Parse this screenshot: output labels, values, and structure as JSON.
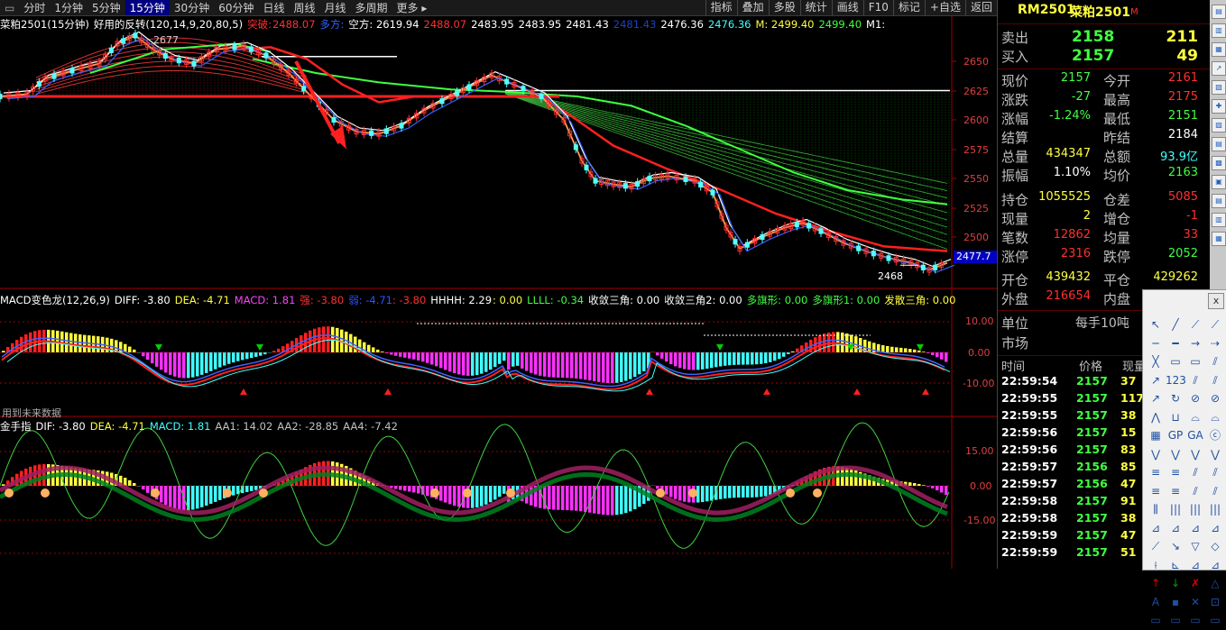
{
  "toolbar": {
    "periods": [
      "分时",
      "1分钟",
      "5分钟",
      "15分钟",
      "30分钟",
      "60分钟",
      "日线",
      "周线",
      "月线",
      "多周期",
      "更多 ▸"
    ],
    "active_period": "15分钟",
    "right_tools": [
      "指标",
      "叠加",
      "多股",
      "统计",
      "画线",
      "F10",
      "标记",
      "+自选",
      "返回"
    ]
  },
  "main_header": {
    "symbol_period": "菜粕2501(15分钟)",
    "indicator": "好用的反转(120,14,9,20,80,5)",
    "tupo_label": "突破:",
    "tupo_value": "2488.07",
    "duofang": "多方:",
    "kongfang": "空方: 2619.94",
    "v1": "2488.07",
    "v2": "2483.95",
    "v3": "2483.95",
    "v4": "2481.43",
    "v5": "2481.43",
    "v6": "2476.36",
    "v7": "2476.36",
    "m_label": "M: 2499.40",
    "m2": "2499.40",
    "m1_label": "M1:"
  },
  "main_axis": {
    "ticks": [
      "2650",
      "2625",
      "2600",
      "2575",
      "2550",
      "2525",
      "2500"
    ],
    "current_price_tag": "2477.7",
    "low_marker": "2468",
    "high_marker": "2677"
  },
  "macd_header": {
    "name": "MACD变色龙(12,26,9)",
    "diff": "DIFF: -3.80",
    "dea": "DEA: -4.71",
    "macd": "MACD: 1.81",
    "qiang": "强: -3.80",
    "ruo": "弱: -4.71",
    "ruo2": ": -3.80",
    "hhhh": "HHHH: 2.29",
    "hhhh2": ": 0.00",
    "llll": "LLLL: -0.34",
    "sl1": "收敛三角: 0.00",
    "sl2": "收敛三角2: 0.00",
    "dqx": "多旗形: 0.00",
    "dqx1": "多旗形1: 0.00",
    "fssj": "发散三角: 0.00",
    "ticks": [
      "10.00",
      "0.00",
      "-10.00"
    ],
    "note": "用到未来数据"
  },
  "jsz_header": {
    "name": "金手指",
    "dif": "DIF: -3.80",
    "dea": "DEA: -4.71",
    "macd": "MACD: 1.81",
    "aa1": "AA1: 14.02",
    "aa2": "AA2: -28.85",
    "aa4": "AA4: -7.42",
    "ticks": [
      "15.00",
      "0.00",
      "-15.00"
    ]
  },
  "quote": {
    "code": "RM2501",
    "name": "菜粕2501",
    "market_flag": "M",
    "sell_label": "卖出",
    "sell_price": "2158",
    "sell_vol": "211",
    "buy_label": "买入",
    "buy_price": "2157",
    "buy_vol": "49",
    "rows": [
      {
        "l1": "现价",
        "v1": "2157",
        "l2": "今开",
        "v2": "2161"
      },
      {
        "l1": "涨跌",
        "v1": "-27",
        "l2": "最高",
        "v2": "2175"
      },
      {
        "l1": "涨幅",
        "v1": "-1.24%",
        "l2": "最低",
        "v2": "2151"
      },
      {
        "l1": "结算",
        "v1": "",
        "l2": "昨结",
        "v2": "2184"
      },
      {
        "l1": "总量",
        "v1": "434347",
        "l2": "总额",
        "v2": "93.9亿"
      },
      {
        "l1": "振幅",
        "v1": "1.10%",
        "l2": "均价",
        "v2": "2163"
      },
      {
        "l1": "持仓",
        "v1": "1055525",
        "l2": "仓差",
        "v2": "5085"
      },
      {
        "l1": "现量",
        "v1": "2",
        "l2": "增仓",
        "v2": "-1"
      },
      {
        "l1": "笔数",
        "v1": "12862",
        "l2": "均量",
        "v2": "33"
      },
      {
        "l1": "涨停",
        "v1": "2316",
        "l2": "跌停",
        "v2": "2052"
      },
      {
        "l1": "开仓",
        "v1": "439432",
        "l2": "平仓",
        "v2": "429262"
      },
      {
        "l1": "外盘",
        "v1": "216654",
        "l2": "内盘",
        "v2": ""
      }
    ],
    "unit_label": "单位",
    "unit_value": "每手10吨",
    "market_label": "市场",
    "tick_headers": [
      "时间",
      "价格",
      "现量"
    ],
    "ticks": [
      {
        "t": "22:59:54",
        "p": "2157",
        "v": "37"
      },
      {
        "t": "22:59:55",
        "p": "2157",
        "v": "117"
      },
      {
        "t": "22:59:55",
        "p": "2157",
        "v": "38"
      },
      {
        "t": "22:59:56",
        "p": "2157",
        "v": "15"
      },
      {
        "t": "22:59:56",
        "p": "2157",
        "v": "83"
      },
      {
        "t": "22:59:57",
        "p": "2156",
        "v": "85"
      },
      {
        "t": "22:59:57",
        "p": "2156",
        "v": "47"
      },
      {
        "t": "22:59:58",
        "p": "2157",
        "v": "91"
      },
      {
        "t": "22:59:58",
        "p": "2157",
        "v": "38"
      },
      {
        "t": "22:59:59",
        "p": "2157",
        "v": "47"
      },
      {
        "t": "22:59:59",
        "p": "2157",
        "v": "51"
      }
    ]
  },
  "draw_panel": {
    "close": "x",
    "tools": [
      "↖",
      "╱",
      "⟋",
      "⟋",
      "─",
      "━",
      "→",
      "⇢",
      "╳",
      "▭",
      "▭",
      "⫽",
      "↗",
      "123",
      "⫽",
      "⫽",
      "↗",
      "↻",
      "⊘",
      "⊘",
      "⋀",
      "⊔",
      "⌓",
      "⌓",
      "▦",
      "GP",
      "GA",
      "ⓒ",
      "⋁",
      "⋁",
      "⋁",
      "⋁",
      "≡",
      "≡",
      "⫽",
      "⫽",
      "≡",
      "≡",
      "⫽",
      "⫽",
      "⫼",
      "|||",
      "|||",
      "|||",
      "⊿",
      "⊿",
      "⊿",
      "⊿",
      "⟋",
      "↘",
      "▽",
      "◇",
      "⟊",
      "⊾",
      "⊿",
      "⊿",
      "↑",
      "↓",
      "✗",
      "△",
      "A",
      "▪",
      "✕",
      "⊡",
      "▭",
      "▭",
      "▭",
      "▭"
    ]
  },
  "colors": {
    "up": "#ff3232",
    "down": "#54ffff",
    "yellow": "#ffff54",
    "green": "#00e000",
    "magenta": "#ff00ff",
    "axis": "#c00000"
  }
}
